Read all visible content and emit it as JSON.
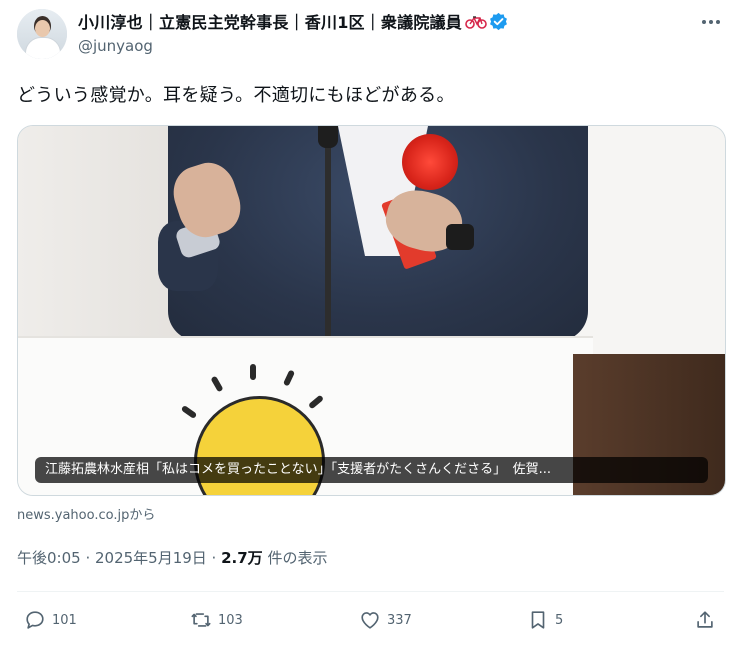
{
  "author": {
    "display_name": "小川淳也｜立憲民主党幹事長｜香川1区｜衆議院議員",
    "handle": "@junyaog",
    "emoji_icon": "bicycle-icon",
    "verified_color": "#1d9bf0"
  },
  "tweet": {
    "text": "どういう感覚か。耳を疑う。不適切にもほどがある。"
  },
  "card": {
    "caption": "江藤拓農林水産相「私はコメを買ったことない」「支援者がたくさんくださる」　佐賀...",
    "source": "news.yahoo.co.jpから"
  },
  "meta": {
    "time": "午後0:05 · 2025年5月19日 · ",
    "views": "2.7万",
    "views_suffix": " 件の表示"
  },
  "actions": {
    "replies": "101",
    "reposts": "103",
    "likes": "337",
    "bookmarks": "5"
  },
  "colors": {
    "text_primary": "#0f1419",
    "text_secondary": "#536471",
    "border": "#cfd9de",
    "verified": "#1d9bf0"
  }
}
